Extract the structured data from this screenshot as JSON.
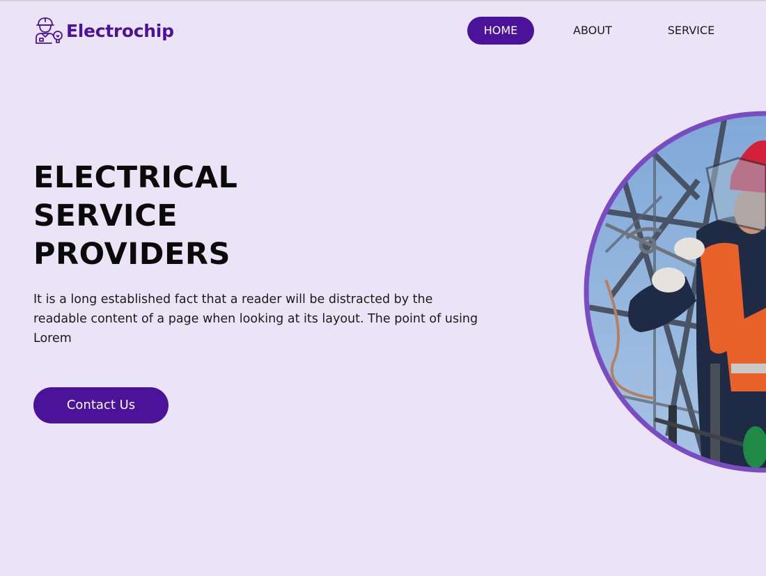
{
  "brand": {
    "name": "Electrochip",
    "logo_icon": "electrician-worker-icon"
  },
  "nav": {
    "items": [
      {
        "label": "HOME",
        "active": true
      },
      {
        "label": "ABOUT",
        "active": false
      },
      {
        "label": "SERVICE",
        "active": false
      }
    ]
  },
  "hero": {
    "title_lines": [
      "ELECTRICAL",
      "SERVICE",
      "PROVIDERS"
    ],
    "description": "It is a long established fact that a reader will be distracted by the readable content of a page when looking at its layout. The point of using Lorem",
    "cta_label": "Contact Us",
    "image_icon": "electrician-working-photo"
  },
  "colors": {
    "background": "#ebe4f6",
    "accent": "#4b1399",
    "image_border": "#7a4cc2"
  }
}
